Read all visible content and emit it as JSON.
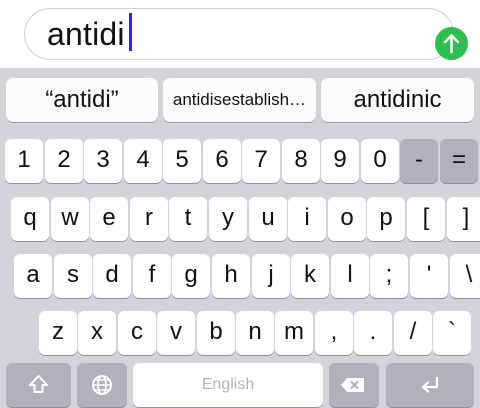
{
  "search": {
    "value": "antidi"
  },
  "suggestions": [
    "“antidi”",
    "antidisestablish…",
    "antidinic"
  ],
  "rows": {
    "numbers": [
      "1",
      "2",
      "3",
      "4",
      "5",
      "6",
      "7",
      "8",
      "9",
      "0",
      "-",
      "="
    ],
    "top": [
      "q",
      "w",
      "e",
      "r",
      "t",
      "y",
      "u",
      "i",
      "o",
      "p",
      "[",
      "]"
    ],
    "middle": [
      "a",
      "s",
      "d",
      "f",
      "g",
      "h",
      "j",
      "k",
      "l",
      ";",
      "'",
      "\\"
    ],
    "bottom": [
      "z",
      "x",
      "c",
      "v",
      "b",
      "n",
      "m",
      ",",
      ".",
      "/",
      "`"
    ]
  },
  "space_label": "English",
  "colors": {
    "send": "#2fbf4e",
    "caret": "#1a2cff",
    "keyboard_bg": "#d2d4da"
  },
  "icons": [
    "send-arrow-icon",
    "shift-icon",
    "globe-icon",
    "delete-icon",
    "return-icon"
  ]
}
